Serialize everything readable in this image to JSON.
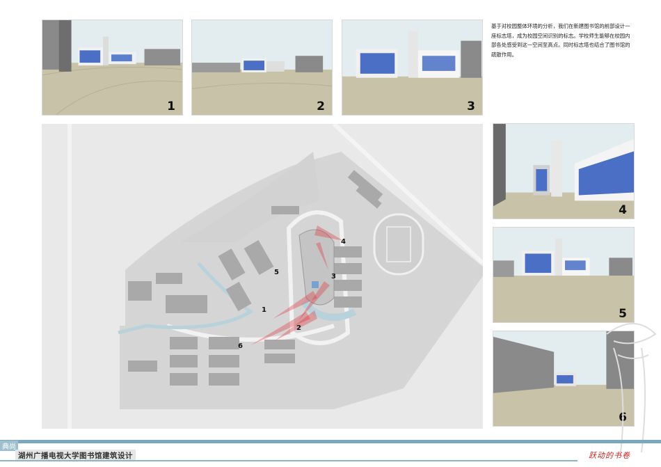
{
  "description": "基于对校园整体环境的分析，我们在新建图书馆的前部设计一座标志塔，成为校园空间识别的标志。学校师生能够在校园内部各处感受到这一空间至高点。同时标志塔也结合了图书馆的疏散作用。",
  "views": [
    {
      "number": "1"
    },
    {
      "number": "2"
    },
    {
      "number": "3"
    },
    {
      "number": "4"
    },
    {
      "number": "5"
    },
    {
      "number": "6"
    }
  ],
  "plan": {
    "markers": [
      {
        "label": "1"
      },
      {
        "label": "2"
      },
      {
        "label": "3"
      },
      {
        "label": "4"
      },
      {
        "label": "5"
      },
      {
        "label": "6"
      }
    ]
  },
  "footer": {
    "tag": "典尚",
    "title": "湖州广播电视大学图书馆建筑设计",
    "slogan": "跃动的书卷"
  },
  "colors": {
    "sky": "#e4eef0",
    "ground": "#c7c2a6",
    "glass": "#4a6fc4",
    "sightline": "#e0303a",
    "water": "#b8d2dc",
    "band": "#7aa8c0"
  }
}
